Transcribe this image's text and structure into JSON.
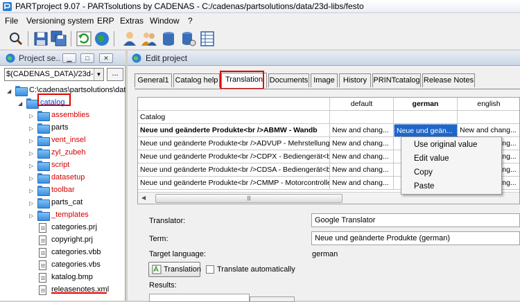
{
  "window": {
    "title": "PARTproject 9.07 - PARTsolutions by CADENAS - C:/cadenas/partsolutions/data/23d-libs/festo"
  },
  "menu": [
    "File",
    "Versioning system",
    "ERP",
    "Extras",
    "Window",
    "?"
  ],
  "toolbar": {
    "icons": [
      "search-icon",
      "save-icon",
      "save-all-icon",
      "refresh-icon",
      "globe-icon",
      "user-icon",
      "users-icon",
      "database-icon",
      "database-settings-icon",
      "table-icon"
    ]
  },
  "left_pane": {
    "title": "Project se...",
    "path": "$(CADENAS_DATA)/23d-libs",
    "more_label": "...",
    "tree": [
      {
        "label": "C:\\cadenas\\partsolutions\\data",
        "type": "folder",
        "color": "normal"
      },
      {
        "label": "catalog",
        "type": "folder",
        "color": "highlight"
      },
      {
        "label": "assemblies",
        "type": "folder",
        "color": "red"
      },
      {
        "label": "parts",
        "type": "folder",
        "color": "normal"
      },
      {
        "label": "vent_insel",
        "type": "folder",
        "color": "red"
      },
      {
        "label": "zyl_zubeh",
        "type": "folder",
        "color": "red"
      },
      {
        "label": "script",
        "type": "folder",
        "color": "red"
      },
      {
        "label": "datasetup",
        "type": "folder",
        "color": "red"
      },
      {
        "label": "toolbar",
        "type": "folder",
        "color": "red"
      },
      {
        "label": "parts_cat",
        "type": "folder",
        "color": "normal"
      },
      {
        "label": "_templates",
        "type": "folder",
        "color": "red"
      },
      {
        "label": "categories.prj",
        "type": "file",
        "color": "normal"
      },
      {
        "label": "copyright.prj",
        "type": "file",
        "color": "normal"
      },
      {
        "label": "categories.vbb",
        "type": "file",
        "color": "normal"
      },
      {
        "label": "categories.vbs",
        "type": "file",
        "color": "normal"
      },
      {
        "label": "katalog.bmp",
        "type": "file",
        "color": "normal"
      },
      {
        "label": "releasenotes.xml",
        "type": "file",
        "color": "normal"
      }
    ]
  },
  "edit_project": {
    "title": "Edit project",
    "tabs": [
      "General1",
      "Catalog help",
      "Translation",
      "Documents",
      "Image",
      "History",
      "PRINTcatalog",
      "Release Notes"
    ],
    "active_tab": "Translation",
    "grid": {
      "columns": [
        "",
        "default",
        "german",
        "english"
      ],
      "rows": [
        [
          "Catalog",
          "",
          "",
          ""
        ],
        [
          "Neue und geänderte Produkte<br />ABMW - Wandb",
          "New and chang...",
          "Neue und geän...",
          "New and chang..."
        ],
        [
          "Neue und geänderte Produkte<br />ADVUP - Mehrstellungsz",
          "New and chang...",
          "",
          "New and chang..."
        ],
        [
          "Neue und geänderte Produkte<br />CDPX - Bediengerät<br",
          "New and chang...",
          "",
          "New and chang..."
        ],
        [
          "Neue und geänderte Produkte<br />CDSA - Bediengerät<br",
          "New and chang...",
          "",
          "New and chang..."
        ],
        [
          "Neue und geänderte Produkte<br />CMMP - Motorcontroller<br",
          "New and chang...",
          "",
          "New and chang..."
        ]
      ]
    },
    "context_menu": [
      "Use original value",
      "Edit value",
      "Copy",
      "Paste"
    ],
    "form": {
      "translator_label": "Translator:",
      "translator_value": "Google Translator",
      "term_label": "Term:",
      "term_value": "Neue und geänderte Produkte (german)",
      "target_language_label": "Target language:",
      "target_language_value": "german",
      "translation_button": "Translation",
      "translate_auto_label": "Translate automatically",
      "results_label": "Results:"
    }
  },
  "colors": {
    "highlight_red": "#e00000",
    "selection_blue": "#1e66c8",
    "folder_blue": "#3b8ee0"
  }
}
